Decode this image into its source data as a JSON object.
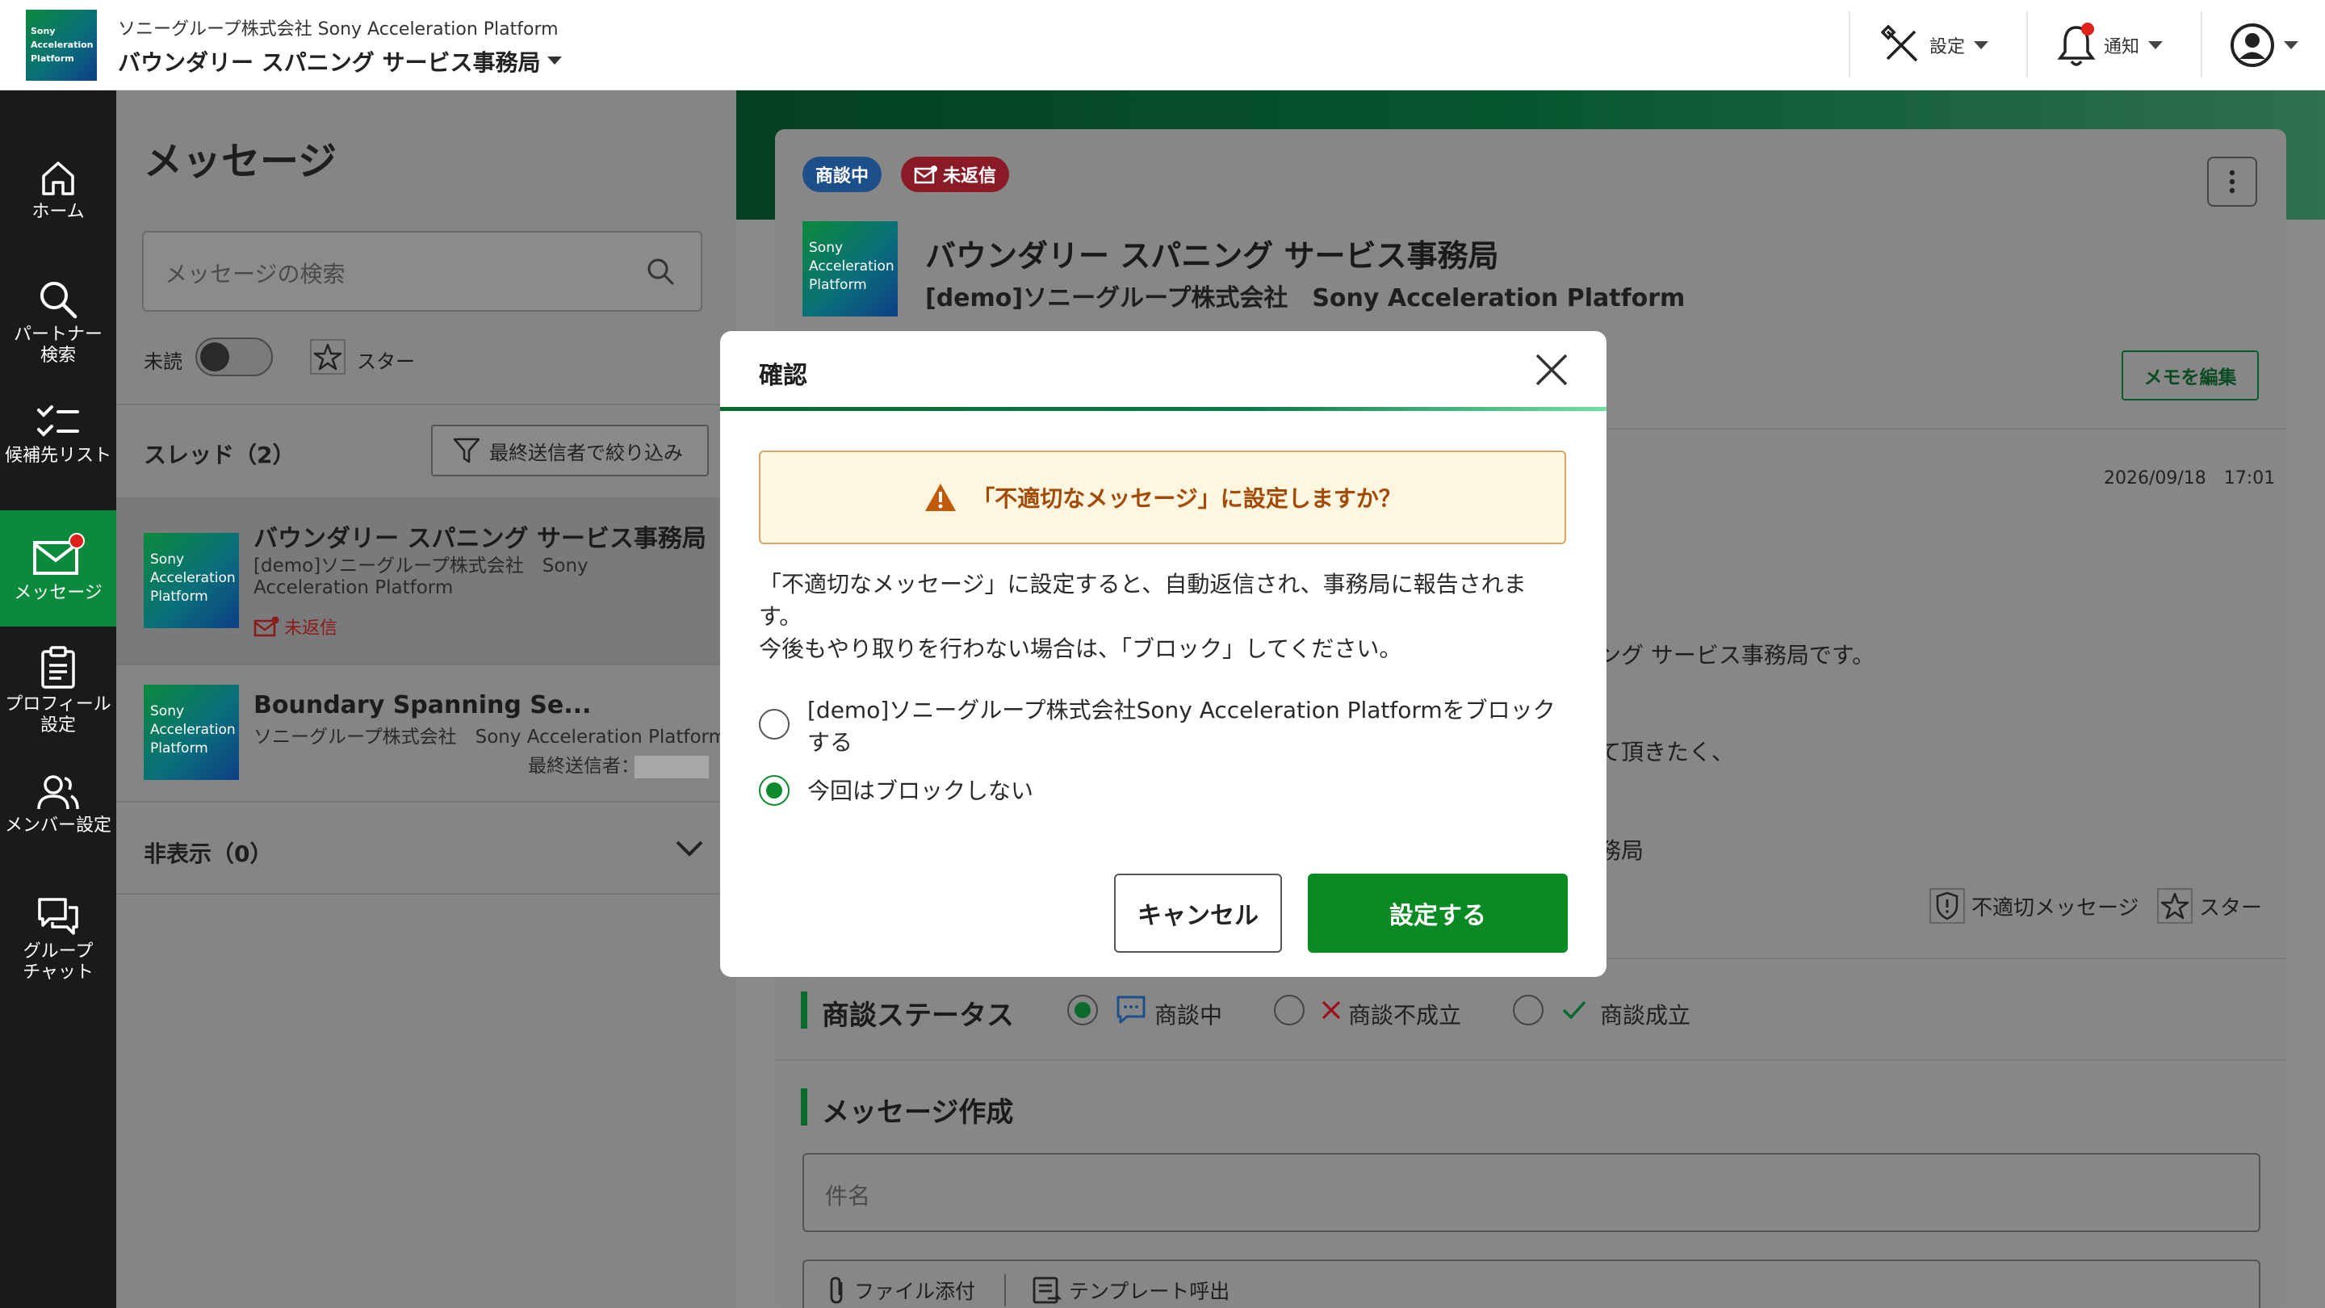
{
  "header": {
    "logo_text": [
      "Sony",
      "Acceleration",
      "Platform"
    ],
    "org": "ソニーグループ株式会社 Sony Acceleration Platform",
    "workspace": "バウンダリー スパニング サービス事務局",
    "settings_label": "設定",
    "notifications_label": "通知"
  },
  "nav": {
    "items": [
      {
        "label": "ホーム",
        "icon": "home-icon"
      },
      {
        "label": "パートナー\n検索",
        "icon": "search-icon"
      },
      {
        "label": "候補先リスト",
        "icon": "checklist-icon"
      },
      {
        "label": "メッセージ",
        "icon": "mail-icon"
      },
      {
        "label": "プロフィール\n設定",
        "icon": "clipboard-icon"
      },
      {
        "label": "メンバー設定",
        "icon": "people-icon"
      },
      {
        "label": "グループ\nチャット",
        "icon": "chat-icon"
      }
    ]
  },
  "list": {
    "title": "メッセージ",
    "search_placeholder": "メッセージの検索",
    "unread_label": "未読",
    "star_label": "スター",
    "threads_label": "スレッド（2）",
    "filter_label": "最終送信者で絞り込み",
    "threads": [
      {
        "name": "バウンダリー スパニング サービス事務局",
        "org": "[demo]ソニーグループ株式会社　Sony Acceleration Platform",
        "status": "未返信"
      },
      {
        "name": "Boundary Spanning Se...",
        "org": "ソニーグループ株式会社　Sony Acceleration Platform",
        "last_sender_label": "最終送信者："
      }
    ],
    "hidden_label": "非表示（0）"
  },
  "detail": {
    "badge_negotiating": "商談中",
    "badge_unreplied": "未返信",
    "title": "バウンダリー スパニング サービス事務局",
    "subtitle": "[demo]ソニーグループ株式会社　Sony Acceleration Platform",
    "memo_button": "メモを編集",
    "date": "2026/09/18　17:01",
    "msg_fragment_1": "ング サービス事務局です。",
    "msg_fragment_2": "て頂きたく、",
    "msg_fragment_3": "務局",
    "inappropriate_label": "不適切メッセージ",
    "star_label": "スター",
    "status_section": "商談ステータス",
    "status_options": [
      "商談中",
      "商談不成立",
      "商談成立"
    ],
    "compose_section": "メッセージ作成",
    "subject_placeholder": "件名",
    "attach_label": "ファイル添付",
    "template_label": "テンプレート呼出"
  },
  "modal": {
    "title": "確認",
    "warning": "「不適切なメッセージ」に設定しますか？",
    "body_1": "「不適切なメッセージ」に設定すると、自動返信され、事務局に報告されます。",
    "body_2": "今後もやり取りを行わない場合は、「ブロック」してください。",
    "option_block": "[demo]ソニーグループ株式会社Sony Acceleration Platformをブロックする",
    "option_noblock": "今回はブロックしない",
    "cancel": "キャンセル",
    "confirm": "設定する"
  },
  "colors": {
    "brand_green": "#0a8a22",
    "unreplied_red": "#b0182a",
    "negotiating_blue": "#1d4f8a",
    "warning_orange": "#c05a0a"
  }
}
